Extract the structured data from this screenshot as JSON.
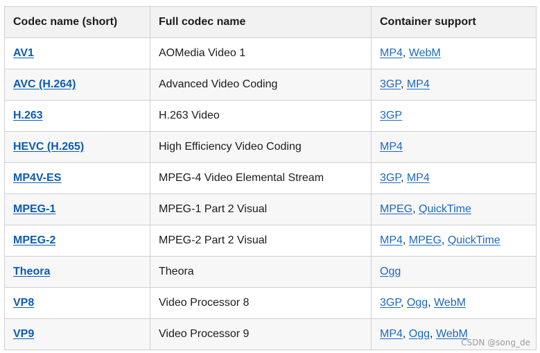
{
  "table": {
    "headers": [
      "Codec name (short)",
      "Full codec name",
      "Container support"
    ],
    "rows": [
      {
        "short": "AV1",
        "full": "AOMedia Video 1",
        "containers": [
          "MP4",
          "WebM"
        ]
      },
      {
        "short": "AVC (H.264)",
        "full": "Advanced Video Coding",
        "containers": [
          "3GP",
          "MP4"
        ]
      },
      {
        "short": "H.263",
        "full": "H.263 Video",
        "containers": [
          "3GP"
        ]
      },
      {
        "short": "HEVC (H.265)",
        "full": "High Efficiency Video Coding",
        "containers": [
          "MP4"
        ]
      },
      {
        "short": "MP4V-ES",
        "full": "MPEG-4 Video Elemental Stream",
        "containers": [
          "3GP",
          "MP4"
        ]
      },
      {
        "short": "MPEG-1",
        "full": "MPEG-1 Part 2 Visual",
        "containers": [
          "MPEG",
          "QuickTime"
        ]
      },
      {
        "short": "MPEG-2",
        "full": "MPEG-2 Part 2 Visual",
        "containers": [
          "MP4",
          "MPEG",
          "QuickTime"
        ]
      },
      {
        "short": "Theora",
        "full": "Theora",
        "containers": [
          "Ogg"
        ]
      },
      {
        "short": "VP8",
        "full": "Video Processor 8",
        "containers": [
          "3GP",
          "Ogg",
          "WebM"
        ]
      },
      {
        "short": "VP9",
        "full": "Video Processor 9",
        "containers": [
          "MP4",
          "Ogg",
          "WebM"
        ]
      }
    ]
  },
  "watermark": "CSDN @song_de",
  "colors": {
    "link": "#0a5bb6",
    "header_bg": "#f2f2f2",
    "border": "#cfcfcf"
  }
}
